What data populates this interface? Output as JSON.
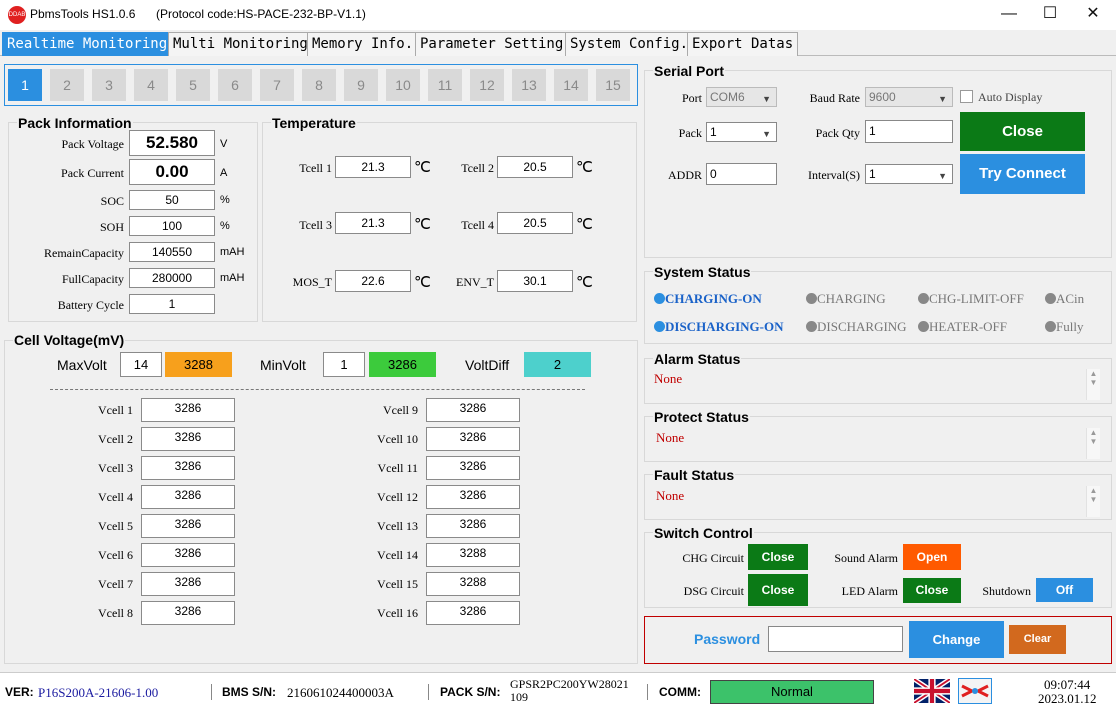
{
  "window": {
    "title": "PbmsTools HS1.0.6",
    "protocol": "(Protocol code:HS-PACE-232-BP-V1.1)",
    "logo_text": "DDAB"
  },
  "tabs": [
    "Realtime Monitoring",
    "Multi Monitoring",
    "Memory Info.",
    "Parameter Setting",
    "System Config.",
    "Export Datas"
  ],
  "packs": [
    "1",
    "2",
    "3",
    "4",
    "5",
    "6",
    "7",
    "8",
    "9",
    "10",
    "11",
    "12",
    "13",
    "14",
    "15"
  ],
  "pack_info": {
    "title": "Pack Information",
    "voltage": {
      "label": "Pack Voltage",
      "value": "52.580",
      "unit": "V"
    },
    "current": {
      "label": "Pack Current",
      "value": "0.00",
      "unit": "A"
    },
    "soc": {
      "label": "SOC",
      "value": "50",
      "unit": "%"
    },
    "soh": {
      "label": "SOH",
      "value": "100",
      "unit": "%"
    },
    "remain": {
      "label": "RemainCapacity",
      "value": "140550",
      "unit": "mAH"
    },
    "full": {
      "label": "FullCapacity",
      "value": "280000",
      "unit": "mAH"
    },
    "cycle": {
      "label": "Battery Cycle",
      "value": "1"
    }
  },
  "temperature": {
    "title": "Temperature",
    "unit": "℃",
    "tcell1": {
      "label": "Tcell 1",
      "value": "21.3"
    },
    "tcell2": {
      "label": "Tcell 2",
      "value": "20.5"
    },
    "tcell3": {
      "label": "Tcell 3",
      "value": "21.3"
    },
    "tcell4": {
      "label": "Tcell 4",
      "value": "20.5"
    },
    "mos": {
      "label": "MOS_T",
      "value": "22.6"
    },
    "env": {
      "label": "ENV_T",
      "value": "30.1"
    }
  },
  "cell_voltage": {
    "title": "Cell Voltage(mV)",
    "max_label": "MaxVolt",
    "max_cell": "14",
    "max_value": "3288",
    "min_label": "MinVolt",
    "min_cell": "1",
    "min_value": "3286",
    "diff_label": "VoltDiff",
    "diff_value": "2",
    "cells": [
      {
        "label": "Vcell 1",
        "value": "3286"
      },
      {
        "label": "Vcell 2",
        "value": "3286"
      },
      {
        "label": "Vcell 3",
        "value": "3286"
      },
      {
        "label": "Vcell 4",
        "value": "3286"
      },
      {
        "label": "Vcell 5",
        "value": "3286"
      },
      {
        "label": "Vcell 6",
        "value": "3286"
      },
      {
        "label": "Vcell 7",
        "value": "3286"
      },
      {
        "label": "Vcell 8",
        "value": "3286"
      },
      {
        "label": "Vcell 9",
        "value": "3286"
      },
      {
        "label": "Vcell 10",
        "value": "3286"
      },
      {
        "label": "Vcell 11",
        "value": "3286"
      },
      {
        "label": "Vcell 12",
        "value": "3286"
      },
      {
        "label": "Vcell 13",
        "value": "3286"
      },
      {
        "label": "Vcell 14",
        "value": "3288"
      },
      {
        "label": "Vcell 15",
        "value": "3288"
      },
      {
        "label": "Vcell 16",
        "value": "3286"
      }
    ]
  },
  "serial_port": {
    "title": "Serial Port",
    "port_label": "Port",
    "port_value": "COM6",
    "baud_label": "Baud Rate",
    "baud_value": "9600",
    "auto_display": "Auto Display",
    "pack_label": "Pack",
    "pack_value": "1",
    "packqty_label": "Pack Qty",
    "packqty_value": "1",
    "addr_label": "ADDR",
    "addr_value": "0",
    "interval_label": "Interval(S)",
    "interval_value": "1",
    "close_btn": "Close",
    "try_btn": "Try Connect"
  },
  "system_status": {
    "title": "System Status",
    "items": [
      {
        "label": "CHARGING-ON",
        "active": true
      },
      {
        "label": "CHARGING",
        "active": false
      },
      {
        "label": "CHG-LIMIT-OFF",
        "active": false
      },
      {
        "label": "ACin",
        "active": false
      },
      {
        "label": "DISCHARGING-ON",
        "active": true
      },
      {
        "label": "DISCHARGING",
        "active": false
      },
      {
        "label": "HEATER-OFF",
        "active": false
      },
      {
        "label": "Fully",
        "active": false
      }
    ]
  },
  "alarm_status": {
    "title": "Alarm Status",
    "value": "None"
  },
  "protect_status": {
    "title": "Protect Status",
    "value": "None"
  },
  "fault_status": {
    "title": "Fault Status",
    "value": "None"
  },
  "switch_control": {
    "title": "Switch Control",
    "chg_label": "CHG Circuit",
    "chg_btn": "Close",
    "sound_label": "Sound Alarm",
    "sound_btn": "Open",
    "dsg_label": "DSG Circuit",
    "dsg_btn": "Close",
    "led_label": "LED Alarm",
    "led_btn": "Close",
    "shutdown_label": "Shutdown",
    "shutdown_btn": "Off"
  },
  "password": {
    "label": "Password",
    "value": "",
    "change_btn": "Change",
    "clear_btn": "Clear"
  },
  "statusbar": {
    "ver_label": "VER:",
    "ver_value": "P16S200A-21606-1.00",
    "bms_label": "BMS S/N:",
    "bms_value": "216061024400003A",
    "pack_label": "PACK S/N:",
    "pack_value_1": "GPSR2PC200YW28021",
    "pack_value_2": "109",
    "comm_label": "COMM:",
    "comm_value": "Normal",
    "time": "09:07:44",
    "date": "2023.01.12"
  },
  "colors": {
    "accent": "#2b8fe0",
    "green": "#0b7a16",
    "orange": "#ff5a00",
    "max_bg": "#f7a01c",
    "min_bg": "#3ccb3c",
    "diff_bg": "#4dd0cc",
    "brown": "#d2691e",
    "comm_bg": "#3cc26a"
  }
}
